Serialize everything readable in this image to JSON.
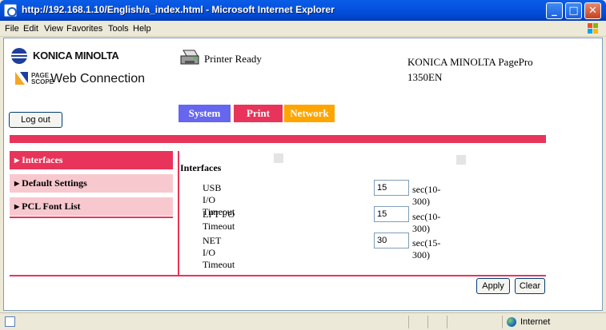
{
  "window": {
    "title": "http://192.168.1.10/English/a_index.html - Microsoft Internet Explorer",
    "controls": [
      "_",
      "□",
      "✕"
    ]
  },
  "menu": [
    "File",
    "Edit",
    "View",
    "Favorites",
    "Tools",
    "Help"
  ],
  "header": {
    "brand": "KONICA MINOLTA",
    "pagescope_line1": "PAGE",
    "pagescope_line2": "SCOPE",
    "web_connection": "Web Connection",
    "status": "Printer Ready",
    "model_line1": "KONICA MINOLTA PagePro",
    "model_line2": "1350EN"
  },
  "logout_label": "Log out",
  "tabs": [
    {
      "label": "System",
      "color": "#6666ee"
    },
    {
      "label": "Print",
      "color": "#e8345a"
    },
    {
      "label": "Network",
      "color": "#ffa500"
    }
  ],
  "sidebar": {
    "items": [
      {
        "label": "Interfaces",
        "active": true
      },
      {
        "label": "Default Settings",
        "active": false
      },
      {
        "label": "PCL Font List",
        "active": false
      }
    ],
    "arrow": "▶"
  },
  "section": {
    "title": "Interfaces",
    "fields": [
      {
        "label": "USB I/O Timeout",
        "value": "15",
        "unit": "sec(10-300)"
      },
      {
        "label": "LPT I/O Timeout",
        "value": "15",
        "unit": "sec(10-300)"
      },
      {
        "label": "NET I/O Timeout",
        "value": "30",
        "unit": "sec(15-300)"
      }
    ]
  },
  "buttons": {
    "apply": "Apply",
    "clear": "Clear"
  },
  "statusbar": {
    "zone": "Internet"
  },
  "colors": {
    "accent": "#e8345a",
    "accent_light": "#f7c9cf",
    "titlebar": "#0553e0"
  }
}
